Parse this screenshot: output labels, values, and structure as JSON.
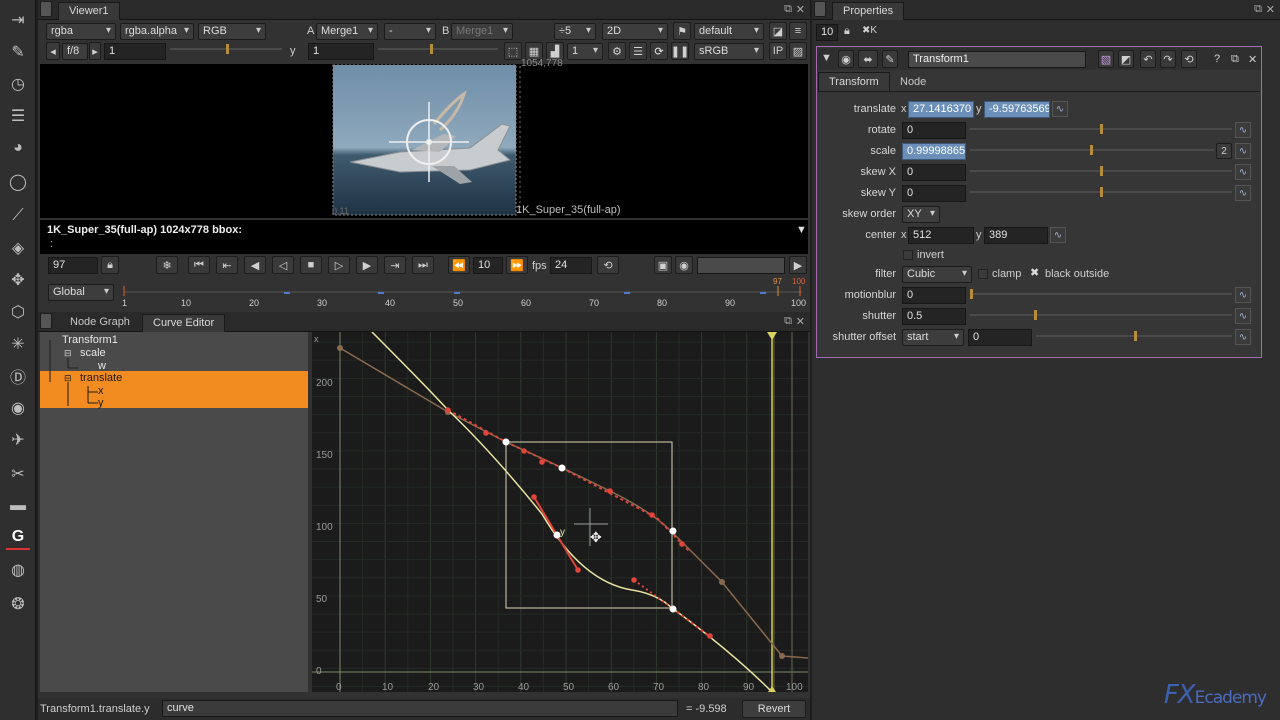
{
  "viewer": {
    "tab": "Viewer1",
    "channels": "rgba",
    "alpha": "rgba.alpha",
    "display_mode": "RGB",
    "input_a_label": "A",
    "input_a": "Merge1",
    "op": "-",
    "input_b_label": "B",
    "input_b": "Merge1",
    "zoom": "÷5",
    "view_mode": "2D",
    "lut": "default",
    "fstop": "f/8",
    "gain": "1",
    "gamma_label": "y",
    "gamma": "1",
    "proxy": "1",
    "colorspace": "sRGB",
    "format_top": "1054,778",
    "format_bottom": "1K_Super_35(full-ap)",
    "origin": "0,11",
    "info": "1K_Super_35(full-ap) 1024x778 bbox:",
    "info_dots": ":"
  },
  "timeline": {
    "frame": "97",
    "step": "10",
    "fps_label": "fps",
    "fps": "24",
    "range_mode": "Global",
    "ticks": [
      "1",
      "10",
      "20",
      "30",
      "40",
      "50",
      "60",
      "70",
      "80",
      "90",
      "100"
    ],
    "marker_current": "97",
    "marker_end": "100"
  },
  "graph": {
    "tabs": [
      "Node Graph",
      "Curve Editor"
    ],
    "active_tab": "Curve Editor",
    "tree": [
      {
        "label": "Transform1",
        "level": 0
      },
      {
        "label": "scale",
        "level": 1
      },
      {
        "label": "w",
        "level": 2
      },
      {
        "label": "translate",
        "level": 1
      },
      {
        "label": "x",
        "level": 2
      },
      {
        "label": "y",
        "level": 2
      }
    ],
    "y_axis_corner": "x",
    "y_ticks": [
      "200",
      "150",
      "100",
      "50",
      "0"
    ],
    "x_ticks": [
      "0",
      "10",
      "20",
      "30",
      "40",
      "50",
      "60",
      "70",
      "80",
      "90",
      "100"
    ],
    "curve_label": "y",
    "status_path": "Transform1.translate.y",
    "expression": "curve",
    "value_display": "= -9.598",
    "revert": "Revert"
  },
  "properties": {
    "title": "Properties",
    "max_panels": "10",
    "node_name": "Transform1",
    "tabs": [
      "Transform",
      "Node"
    ],
    "translate_label": "translate",
    "translate_x": "27.1416370",
    "translate_y": "-9.59763569",
    "rotate_label": "rotate",
    "rotate": "0",
    "scale_label": "scale",
    "scale": "0.99998865",
    "scale_channels": "2",
    "skewx_label": "skew X",
    "skewx": "0",
    "skewy_label": "skew Y",
    "skewy": "0",
    "skew_order_label": "skew order",
    "skew_order": "XY",
    "center_label": "center",
    "center_x": "512",
    "center_y": "389",
    "invert_label": "invert",
    "filter_label": "filter",
    "filter": "Cubic",
    "clamp_label": "clamp",
    "black_outside_label": "black outside",
    "motionblur_label": "motionblur",
    "motionblur": "0",
    "shutter_label": "shutter",
    "shutter": "0.5",
    "shutter_offset_label": "shutter offset",
    "shutter_offset": "start",
    "shutter_offset_value": "0",
    "x_label": "x",
    "y_label": "y"
  },
  "watermark": {
    "text": "FX",
    "tail": "Ecademy"
  },
  "colors": {
    "accent": "#f28c20",
    "curve_yellow": "#e8e6a0",
    "curve_red": "#e0443a",
    "selection_blue": "#6c8fb9"
  }
}
